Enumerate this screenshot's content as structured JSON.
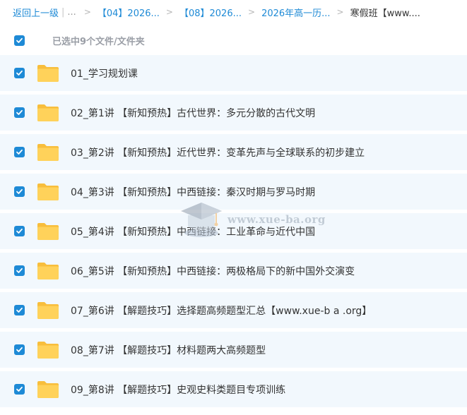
{
  "breadcrumb": {
    "back_label": "返回上一级",
    "ellipsis": "...",
    "items": [
      "【04】2026...",
      "【08】2026...",
      "2026年高一历...",
      "寒假班【www...."
    ],
    "separator": ">"
  },
  "selection": {
    "summary": "已选中9个文件/文件夹",
    "checked": true
  },
  "files": [
    {
      "name": "01_学习规划课",
      "checked": true
    },
    {
      "name": "02_第1讲 【新知预热】古代世界：多元分散的古代文明",
      "checked": true
    },
    {
      "name": "03_第2讲 【新知预热】近代世界：变革先声与全球联系的初步建立",
      "checked": true
    },
    {
      "name": "04_第3讲 【新知预热】中西链接：秦汉时期与罗马时期",
      "checked": true
    },
    {
      "name": "05_第4讲 【新知预热】中西链接：工业革命与近代中国",
      "checked": true
    },
    {
      "name": "06_第5讲 【新知预热】中西链接：两极格局下的新中国外交演变",
      "checked": true
    },
    {
      "name": "07_第6讲 【解题技巧】选择题高频题型汇总【www.xue-b a .org】",
      "checked": true
    },
    {
      "name": "08_第7讲 【解题技巧】材料题两大高频题型",
      "checked": true
    },
    {
      "name": "09_第8讲 【解题技巧】史观史料类题目专项训练",
      "checked": true
    }
  ],
  "watermark": {
    "text": "www.xue-ba.org",
    "icon": "graduation-cap-icon"
  },
  "colors": {
    "accent": "#1e8ad6",
    "row_bg": "#f2f8fd",
    "folder": "#ffd25a"
  }
}
